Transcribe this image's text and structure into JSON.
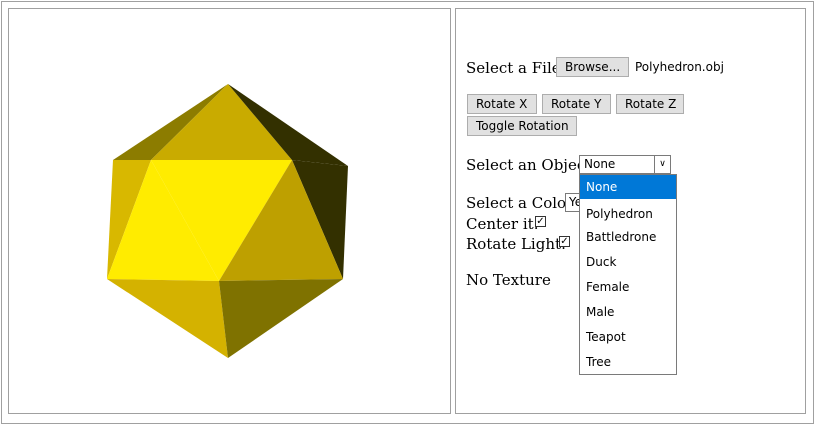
{
  "file": {
    "label": "Select a File:",
    "browse_label": "Browse...",
    "filename": "Polyhedron.obj"
  },
  "rotate": {
    "x_label": "Rotate X",
    "y_label": "Rotate Y",
    "z_label": "Rotate Z",
    "toggle_label": "Toggle Rotation"
  },
  "object": {
    "label": "Select an Object:",
    "selected": "None",
    "options": [
      "None",
      "Polyhedron",
      "Battledrone",
      "Duck",
      "Female",
      "Male",
      "Teapot",
      "Tree"
    ]
  },
  "color": {
    "label": "Select a Color:",
    "selected_visible": "Ye"
  },
  "center": {
    "label": "Center it:",
    "checked": true
  },
  "rotate_light": {
    "label": "Rotate Light:",
    "checked": true
  },
  "texture": {
    "status": "No Texture"
  },
  "colors": {
    "accent": "#0078d7",
    "model_bright": "#ffec00",
    "model_dark": "#333000"
  }
}
